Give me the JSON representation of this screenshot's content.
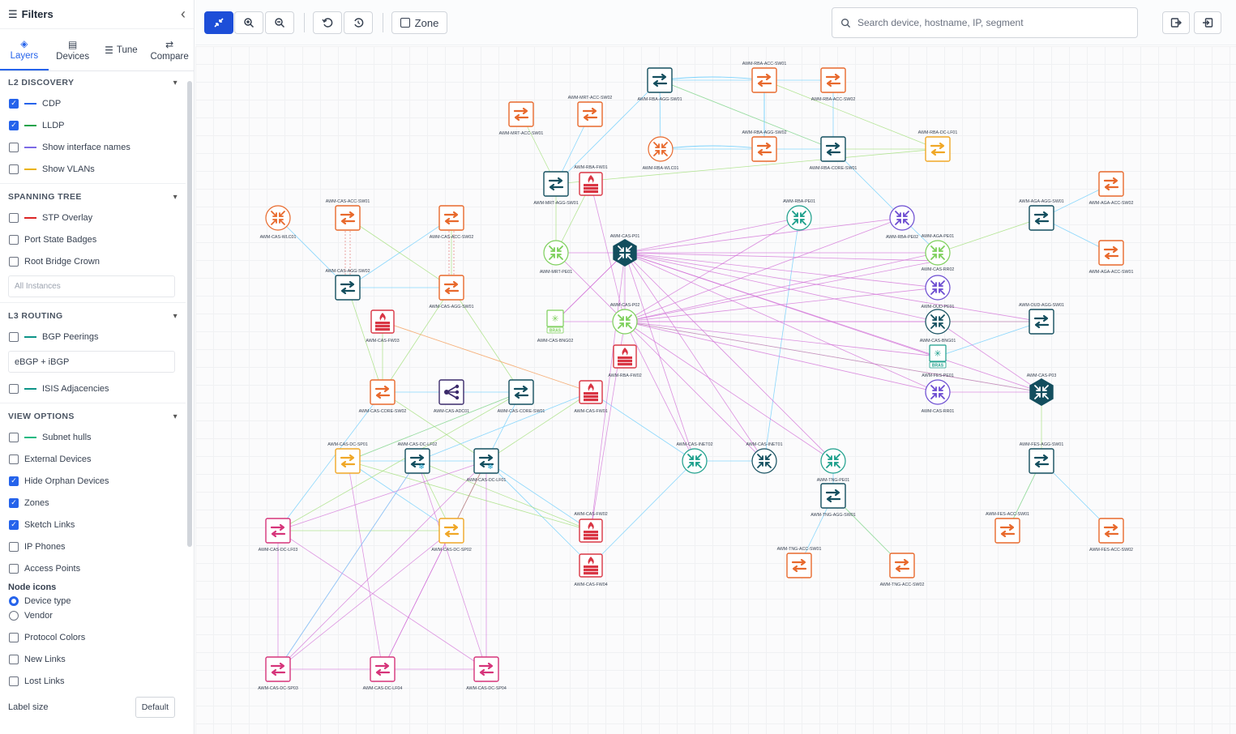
{
  "sidebar": {
    "title": "Filters",
    "tabs": [
      {
        "label": "Layers",
        "icon": "layers-icon"
      },
      {
        "label": "Devices",
        "icon": "devices-icon"
      },
      {
        "label": "Tune",
        "icon": "sliders-icon"
      },
      {
        "label": "Compare",
        "icon": "compare-icon"
      }
    ],
    "l2": {
      "title": "L2 DISCOVERY",
      "items": [
        {
          "label": "CDP",
          "checked": true,
          "color": "#2563eb"
        },
        {
          "label": "LLDP",
          "checked": true,
          "color": "#16a34a"
        },
        {
          "label": "Show interface names",
          "checked": false,
          "color": "#7c6ae6"
        },
        {
          "label": "Show VLANs",
          "checked": false,
          "color": "#eab308"
        }
      ]
    },
    "stp": {
      "title": "SPANNING TREE",
      "items": [
        {
          "label": "STP Overlay",
          "checked": false,
          "color": "#dc2626"
        },
        {
          "label": "Port State Badges",
          "checked": false
        },
        {
          "label": "Root Bridge Crown",
          "checked": false
        }
      ],
      "instances_placeholder": "All Instances"
    },
    "l3": {
      "title": "L3 ROUTING",
      "bgp_label": "BGP Peerings",
      "bgp_color": "#0d9488",
      "bgp_select": "eBGP + iBGP",
      "isis_label": "ISIS Adjacencies",
      "isis_color": "#0d9488"
    },
    "view": {
      "title": "VIEW OPTIONS",
      "items": [
        {
          "label": "Subnet hulls",
          "checked": false,
          "color": "#10b981"
        },
        {
          "label": "External Devices",
          "checked": false
        },
        {
          "label": "Hide Orphan Devices",
          "checked": true
        },
        {
          "label": "Zones",
          "checked": true
        },
        {
          "label": "Sketch Links",
          "checked": true
        },
        {
          "label": "IP Phones",
          "checked": false
        },
        {
          "label": "Access Points",
          "checked": false
        }
      ],
      "node_icons_title": "Node icons",
      "node_icons": [
        {
          "label": "Device type",
          "selected": true
        },
        {
          "label": "Vendor",
          "selected": false
        }
      ],
      "items2": [
        {
          "label": "Protocol Colors",
          "checked": false
        },
        {
          "label": "New Links",
          "checked": false
        },
        {
          "label": "Lost Links",
          "checked": false
        }
      ],
      "label_size_label": "Label size",
      "label_size_value": "Default"
    }
  },
  "toolbar": {
    "zone_label": "Zone",
    "search_placeholder": "Search device, hostname, IP, segment"
  },
  "colors": {
    "access_switch": "#e8692c",
    "agg_switch": "#134e5e",
    "dc_switch": "#f0a726",
    "dc_fabric": "#d6347a",
    "firewall": "#d93644",
    "router_orange": "#e8692c",
    "router_green": "#7ccf5a",
    "router_teal": "#1a9e8a",
    "router_purple": "#6b4bd1",
    "link_cdp": "#7dd3fc",
    "link_lldp": "#a3e07a",
    "link_bgp": "#d06ad6"
  },
  "nodes": [
    {
      "id": "rba_agg1",
      "label": "AWM-RBA-AGG-SW01",
      "type": "agg"
    },
    {
      "id": "rba_acc1",
      "label": "AWM-RBA-ACC-SW01",
      "type": "acc"
    },
    {
      "id": "rba_acc2",
      "label": "AWM-RBA-ACC-SW02",
      "type": "acc"
    },
    {
      "id": "mrt_acc2",
      "label": "AWM-MRT-ACC-SW02",
      "type": "acc"
    },
    {
      "id": "mrt_acc1",
      "label": "AWM-MRT-ACC-SW01",
      "type": "acc"
    },
    {
      "id": "rba_wlc",
      "label": "AWM-RBA-WLC01",
      "type": "rt_orange"
    },
    {
      "id": "rba_agg2",
      "label": "AWM-RBA-AGG-SW02",
      "type": "acc"
    },
    {
      "id": "rba_core",
      "label": "AWM-RBA-CORE-SW01",
      "type": "agg"
    },
    {
      "id": "rba_dc",
      "label": "AWM-RBA-DC-LF01",
      "type": "dc"
    },
    {
      "id": "mrt_agg",
      "label": "AWM-MRT-AGG-SW01",
      "type": "agg"
    },
    {
      "id": "rba_fw",
      "label": "AWM-RBA-FW01",
      "type": "fw"
    },
    {
      "id": "rba_pe1",
      "label": "AWM-RBA-PE01",
      "type": "rt_teal"
    },
    {
      "id": "rba_pe2",
      "label": "AWM-RBA-PE02",
      "type": "rt_purple"
    },
    {
      "id": "aga_agg",
      "label": "AWM-AGA-AGG-SW01",
      "type": "agg"
    },
    {
      "id": "aga_acc2",
      "label": "AWM-AGA-ACC-SW02",
      "type": "acc"
    },
    {
      "id": "aga_acc1",
      "label": "AWM-AGA-ACC-SW01",
      "type": "acc"
    },
    {
      "id": "cas_wlc",
      "label": "AWM-CAS-WLC01",
      "type": "rt_orange"
    },
    {
      "id": "cas_acc1",
      "label": "AWM-CAS-ACC-SW01",
      "type": "acc"
    },
    {
      "id": "cas_acc2",
      "label": "AWM-CAS-ACC-SW02",
      "type": "acc"
    },
    {
      "id": "cas_agg2",
      "label": "AWM-CAS-AGG-SW02",
      "type": "agg"
    },
    {
      "id": "cas_agg1",
      "label": "AWM-CAS-AGG-SW01",
      "type": "acc"
    },
    {
      "id": "mrt_pe",
      "label": "AWM-MRT-PE01",
      "type": "rt_green"
    },
    {
      "id": "cas_p1",
      "label": "AWM-CAS-P01",
      "type": "hex"
    },
    {
      "id": "aga_pe",
      "label": "AWM-AGA-PE01",
      "type": "rt_green"
    },
    {
      "id": "cas_rr2",
      "label": "AWM-CAS-RR02",
      "type": "none"
    },
    {
      "id": "oud_pe",
      "label": "AWM-OUD-PE01",
      "type": "rt_purple"
    },
    {
      "id": "oud_agg",
      "label": "AWM-OUD-AGG-SW01",
      "type": "agg"
    },
    {
      "id": "cas_fw3",
      "label": "AWM-CAS-FW03",
      "type": "fw"
    },
    {
      "id": "cas_bng2",
      "label": "AWM-CAS-BNG02",
      "type": "bras_green"
    },
    {
      "id": "cas_p2",
      "label": "AWM-CAS-P02",
      "type": "rt_green"
    },
    {
      "id": "rba_fw2",
      "label": "AWM-RBA-FW02",
      "type": "fw"
    },
    {
      "id": "cas_bng1",
      "label": "AWM-CAS-BNG01",
      "type": "rt_agg"
    },
    {
      "id": "fes_pe",
      "label": "AWM-FES-PE01",
      "type": "bras_teal"
    },
    {
      "id": "cas_p3",
      "label": "AWM-CAS-P03",
      "type": "hex"
    },
    {
      "id": "cas_rr1",
      "label": "AWM-CAS-RR01",
      "type": "rt_purple"
    },
    {
      "id": "cas_core2",
      "label": "AWM-CAS-CORE-SW02",
      "type": "acc"
    },
    {
      "id": "cas_adc",
      "label": "AWM-CAS-ADC01",
      "type": "adc"
    },
    {
      "id": "cas_core1",
      "label": "AWM-CAS-CORE-SW01",
      "type": "agg"
    },
    {
      "id": "cas_fw1",
      "label": "AWM-CAS-FW01",
      "type": "fw"
    },
    {
      "id": "cas_dcsp1",
      "label": "AWM-CAS-DC-SP01",
      "type": "dc"
    },
    {
      "id": "cas_dclf2",
      "label": "AWM-CAS-DC-LF02",
      "type": "agg_star"
    },
    {
      "id": "cas_dclf1",
      "label": "AWM-CAS-DC-LF01",
      "type": "agg_star"
    },
    {
      "id": "cas_inet2",
      "label": "AWM-CAS-INET02",
      "type": "rt_teal"
    },
    {
      "id": "cas_inet1",
      "label": "AWM-CAS-INET01",
      "type": "rt_agg"
    },
    {
      "id": "tng_pe",
      "label": "AWM-TNG-PE01",
      "type": "rt_teal"
    },
    {
      "id": "tng_agg",
      "label": "AWM-TNG-AGG-SW01",
      "type": "agg"
    },
    {
      "id": "fes_agg",
      "label": "AWM-FES-AGG-SW01",
      "type": "agg"
    },
    {
      "id": "cas_dclf3",
      "label": "AWM-CAS-DC-LF03",
      "type": "fab"
    },
    {
      "id": "cas_dcsp2",
      "label": "AWM-CAS-DC-SP02",
      "type": "dc"
    },
    {
      "id": "cas_fw2",
      "label": "AWM-CAS-FW02",
      "type": "fw"
    },
    {
      "id": "cas_fw4",
      "label": "AWM-CAS-FW04",
      "type": "fw"
    },
    {
      "id": "fes_acc1",
      "label": "AWM-FES-ACC-SW01",
      "type": "acc"
    },
    {
      "id": "fes_acc2",
      "label": "AWM-FES-ACC-SW02",
      "type": "acc"
    },
    {
      "id": "tng_acc1",
      "label": "AWM-TNG-ACC-SW01",
      "type": "acc"
    },
    {
      "id": "tng_acc2",
      "label": "AWM-TNG-ACC-SW02",
      "type": "acc"
    },
    {
      "id": "cas_dcsp3",
      "label": "AWM-CAS-DC-SP03",
      "type": "fab"
    },
    {
      "id": "cas_dclf4",
      "label": "AWM-CAS-DC-LF04",
      "type": "fab"
    },
    {
      "id": "cas_dcsp4",
      "label": "AWM-CAS-DC-SP04",
      "type": "fab"
    }
  ]
}
